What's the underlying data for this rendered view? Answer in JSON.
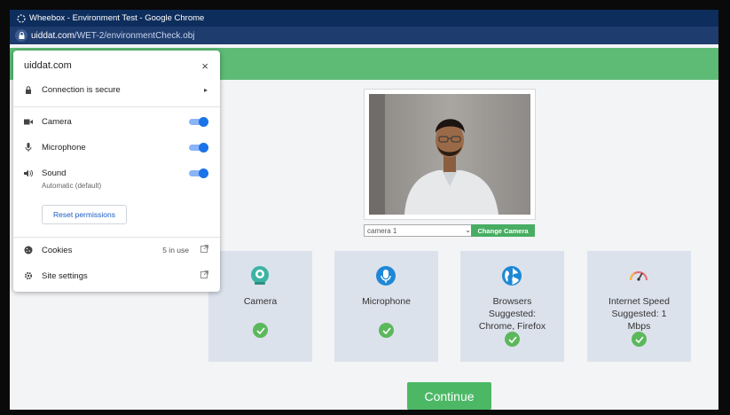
{
  "window": {
    "title": "Wheebox - Environment Test - Google Chrome"
  },
  "address_bar": {
    "host": "uiddat.com",
    "path": "/WET-2/environmentCheck.obj"
  },
  "site_popup": {
    "domain": "uiddat.com",
    "connection": "Connection is secure",
    "permissions": [
      {
        "label": "Camera",
        "enabled": true
      },
      {
        "label": "Microphone",
        "enabled": true
      },
      {
        "label": "Sound",
        "sublabel": "Automatic (default)",
        "enabled": true
      }
    ],
    "reset_label": "Reset permissions",
    "cookies_label": "Cookies",
    "cookies_count": "5 in use",
    "site_settings_label": "Site settings"
  },
  "camera": {
    "select_value": "camera 1",
    "change_label": "Change Camera"
  },
  "checks": [
    {
      "label": "Camera",
      "icon": "webcam-icon",
      "color": "#3cb4a4"
    },
    {
      "label": "Microphone",
      "icon": "microphone-icon",
      "color": "#1e88d6"
    },
    {
      "label": "Browsers Suggested: Chrome, Firefox",
      "icon": "globe-icon",
      "color": "#1e88d6"
    },
    {
      "label": "Internet Speed Suggested: 1 Mbps",
      "icon": "speedometer-icon",
      "color": "#e57373"
    }
  ],
  "continue_label": "Continue",
  "colors": {
    "accent_green": "#5dbb76",
    "toggle_blue": "#1a73e8",
    "titlebar": "#0d2d5c"
  }
}
